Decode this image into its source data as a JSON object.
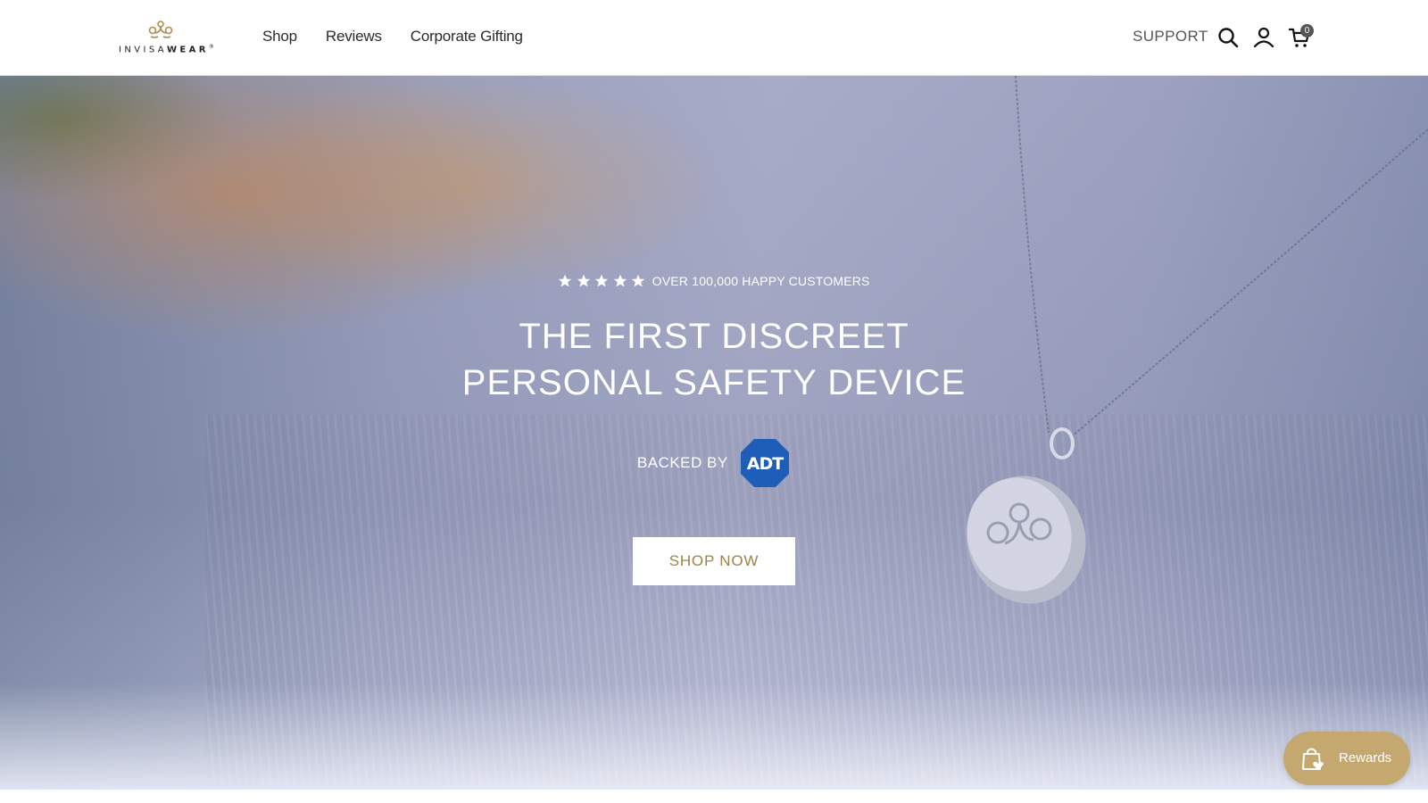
{
  "brand": {
    "logo_text_light": "INVISA",
    "logo_text_bold": "WEAR",
    "logo_mark": "®",
    "accent_color": "#c4a86f",
    "gold_text_color": "#9c8448"
  },
  "header": {
    "nav": [
      {
        "label": "Shop"
      },
      {
        "label": "Reviews"
      },
      {
        "label": "Corporate Gifting"
      }
    ],
    "support_label": "SUPPORT",
    "icons": [
      "search-icon",
      "account-icon",
      "cart-icon"
    ],
    "cart_count": "0"
  },
  "hero": {
    "rating": {
      "stars": 5,
      "text": "OVER 100,000 HAPPY CUSTOMERS"
    },
    "title_line1": "THE FIRST DISCREET",
    "title_line2": "PERSONAL SAFETY DEVICE",
    "backed_by_label": "BACKED BY",
    "partner_logo": "ADT",
    "partner_color": "#1e5eb8",
    "cta_label": "SHOP NOW"
  },
  "rewards": {
    "label": "Rewards",
    "icon": "shopping-bag-heart-icon"
  }
}
